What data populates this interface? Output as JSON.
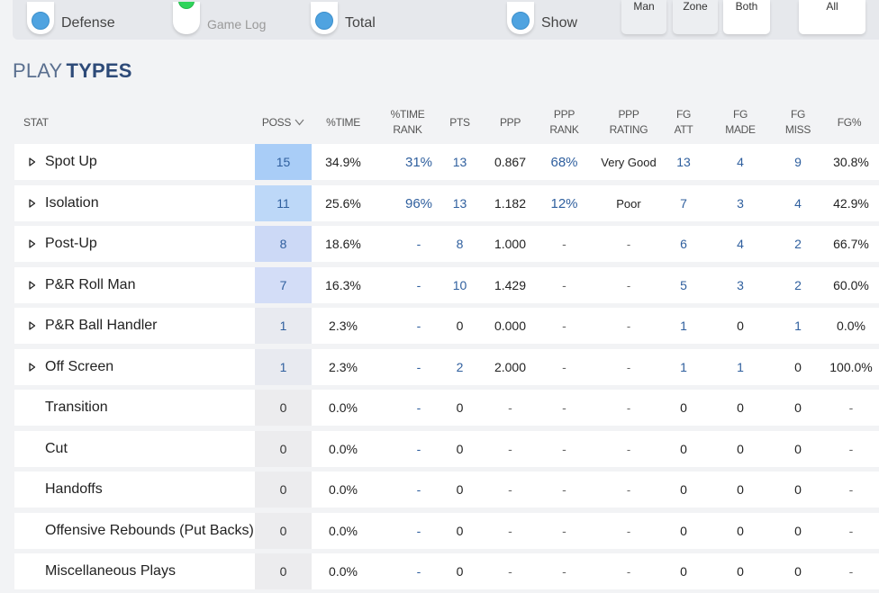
{
  "filters": {
    "defense_label": "Defense",
    "gamelog_label": "Game Log",
    "total_label": "Total",
    "show_label": "Show",
    "man_label": "Man",
    "zone_label": "Zone",
    "both_label": "Both",
    "all_label": "All"
  },
  "heading": {
    "light": "PLAY",
    "bold": "TYPES"
  },
  "table": {
    "headers": {
      "stat": "STAT",
      "poss": "POSS",
      "time": "%TIME",
      "time_rank_1": "%TIME",
      "time_rank_2": "RANK",
      "pts": "PTS",
      "ppp": "PPP",
      "ppp_rank_1": "PPP",
      "ppp_rank_2": "RANK",
      "ppp_rating_1": "PPP",
      "ppp_rating_2": "RATING",
      "fg_att_1": "FG",
      "fg_att_2": "ATT",
      "fg_made_1": "FG",
      "fg_made_2": "MADE",
      "fg_miss_1": "FG",
      "fg_miss_2": "MISS",
      "fg_pct": "FG%"
    },
    "rows": [
      {
        "name": "Spot Up",
        "expandable": true,
        "poss": "15",
        "poss_shade": "#a9cdf7",
        "time": "34.9%",
        "time_rank": "31%",
        "pts": "13",
        "ppp": "0.867",
        "ppp_rank": "68%",
        "rating": "Very Good",
        "att": "13",
        "made": "4",
        "miss": "9",
        "fgpct": "30.8%"
      },
      {
        "name": "Isolation",
        "expandable": true,
        "poss": "11",
        "poss_shade": "#bdd8f8",
        "time": "25.6%",
        "time_rank": "96%",
        "pts": "13",
        "ppp": "1.182",
        "ppp_rank": "12%",
        "rating": "Poor",
        "att": "7",
        "made": "3",
        "miss": "4",
        "fgpct": "42.9%"
      },
      {
        "name": "Post-Up",
        "expandable": true,
        "poss": "8",
        "poss_shade": "#ccd9f6",
        "time": "18.6%",
        "time_rank": "-",
        "pts": "8",
        "ppp": "1.000",
        "ppp_rank": "-",
        "rating": "-",
        "att": "6",
        "made": "4",
        "miss": "2",
        "fgpct": "66.7%"
      },
      {
        "name": "P&R Roll Man",
        "expandable": true,
        "poss": "7",
        "poss_shade": "#d3ddf7",
        "time": "16.3%",
        "time_rank": "-",
        "pts": "10",
        "ppp": "1.429",
        "ppp_rank": "-",
        "rating": "-",
        "att": "5",
        "made": "3",
        "miss": "2",
        "fgpct": "60.0%"
      },
      {
        "name": "P&R Ball Handler",
        "expandable": true,
        "poss": "1",
        "poss_shade": "#e8eaf0",
        "time": "2.3%",
        "time_rank": "-",
        "pts": "0",
        "ppp": "0.000",
        "ppp_rank": "-",
        "rating": "-",
        "att": "1",
        "made": "0",
        "miss": "1",
        "fgpct": "0.0%"
      },
      {
        "name": "Off Screen",
        "expandable": true,
        "poss": "1",
        "poss_shade": "#e8eaf0",
        "time": "2.3%",
        "time_rank": "-",
        "pts": "2",
        "ppp": "2.000",
        "ppp_rank": "-",
        "rating": "-",
        "att": "1",
        "made": "1",
        "miss": "0",
        "fgpct": "100.0%"
      },
      {
        "name": "Transition",
        "expandable": false,
        "poss": "0",
        "poss_shade": "#ececee",
        "time": "0.0%",
        "time_rank": "-",
        "pts": "0",
        "ppp": "-",
        "ppp_rank": "-",
        "rating": "-",
        "att": "0",
        "made": "0",
        "miss": "0",
        "fgpct": "-"
      },
      {
        "name": "Cut",
        "expandable": false,
        "poss": "0",
        "poss_shade": "#ececee",
        "time": "0.0%",
        "time_rank": "-",
        "pts": "0",
        "ppp": "-",
        "ppp_rank": "-",
        "rating": "-",
        "att": "0",
        "made": "0",
        "miss": "0",
        "fgpct": "-"
      },
      {
        "name": "Handoffs",
        "expandable": false,
        "poss": "0",
        "poss_shade": "#ececee",
        "time": "0.0%",
        "time_rank": "-",
        "pts": "0",
        "ppp": "-",
        "ppp_rank": "-",
        "rating": "-",
        "att": "0",
        "made": "0",
        "miss": "0",
        "fgpct": "-"
      },
      {
        "name": "Offensive Rebounds (Put Backs)",
        "expandable": false,
        "poss": "0",
        "poss_shade": "#ececee",
        "time": "0.0%",
        "time_rank": "-",
        "pts": "0",
        "ppp": "-",
        "ppp_rank": "-",
        "rating": "-",
        "att": "0",
        "made": "0",
        "miss": "0",
        "fgpct": "-"
      },
      {
        "name": "Miscellaneous Plays",
        "expandable": false,
        "poss": "0",
        "poss_shade": "#ececee",
        "time": "0.0%",
        "time_rank": "-",
        "pts": "0",
        "ppp": "-",
        "ppp_rank": "-",
        "rating": "-",
        "att": "0",
        "made": "0",
        "miss": "0",
        "fgpct": "-"
      }
    ]
  }
}
